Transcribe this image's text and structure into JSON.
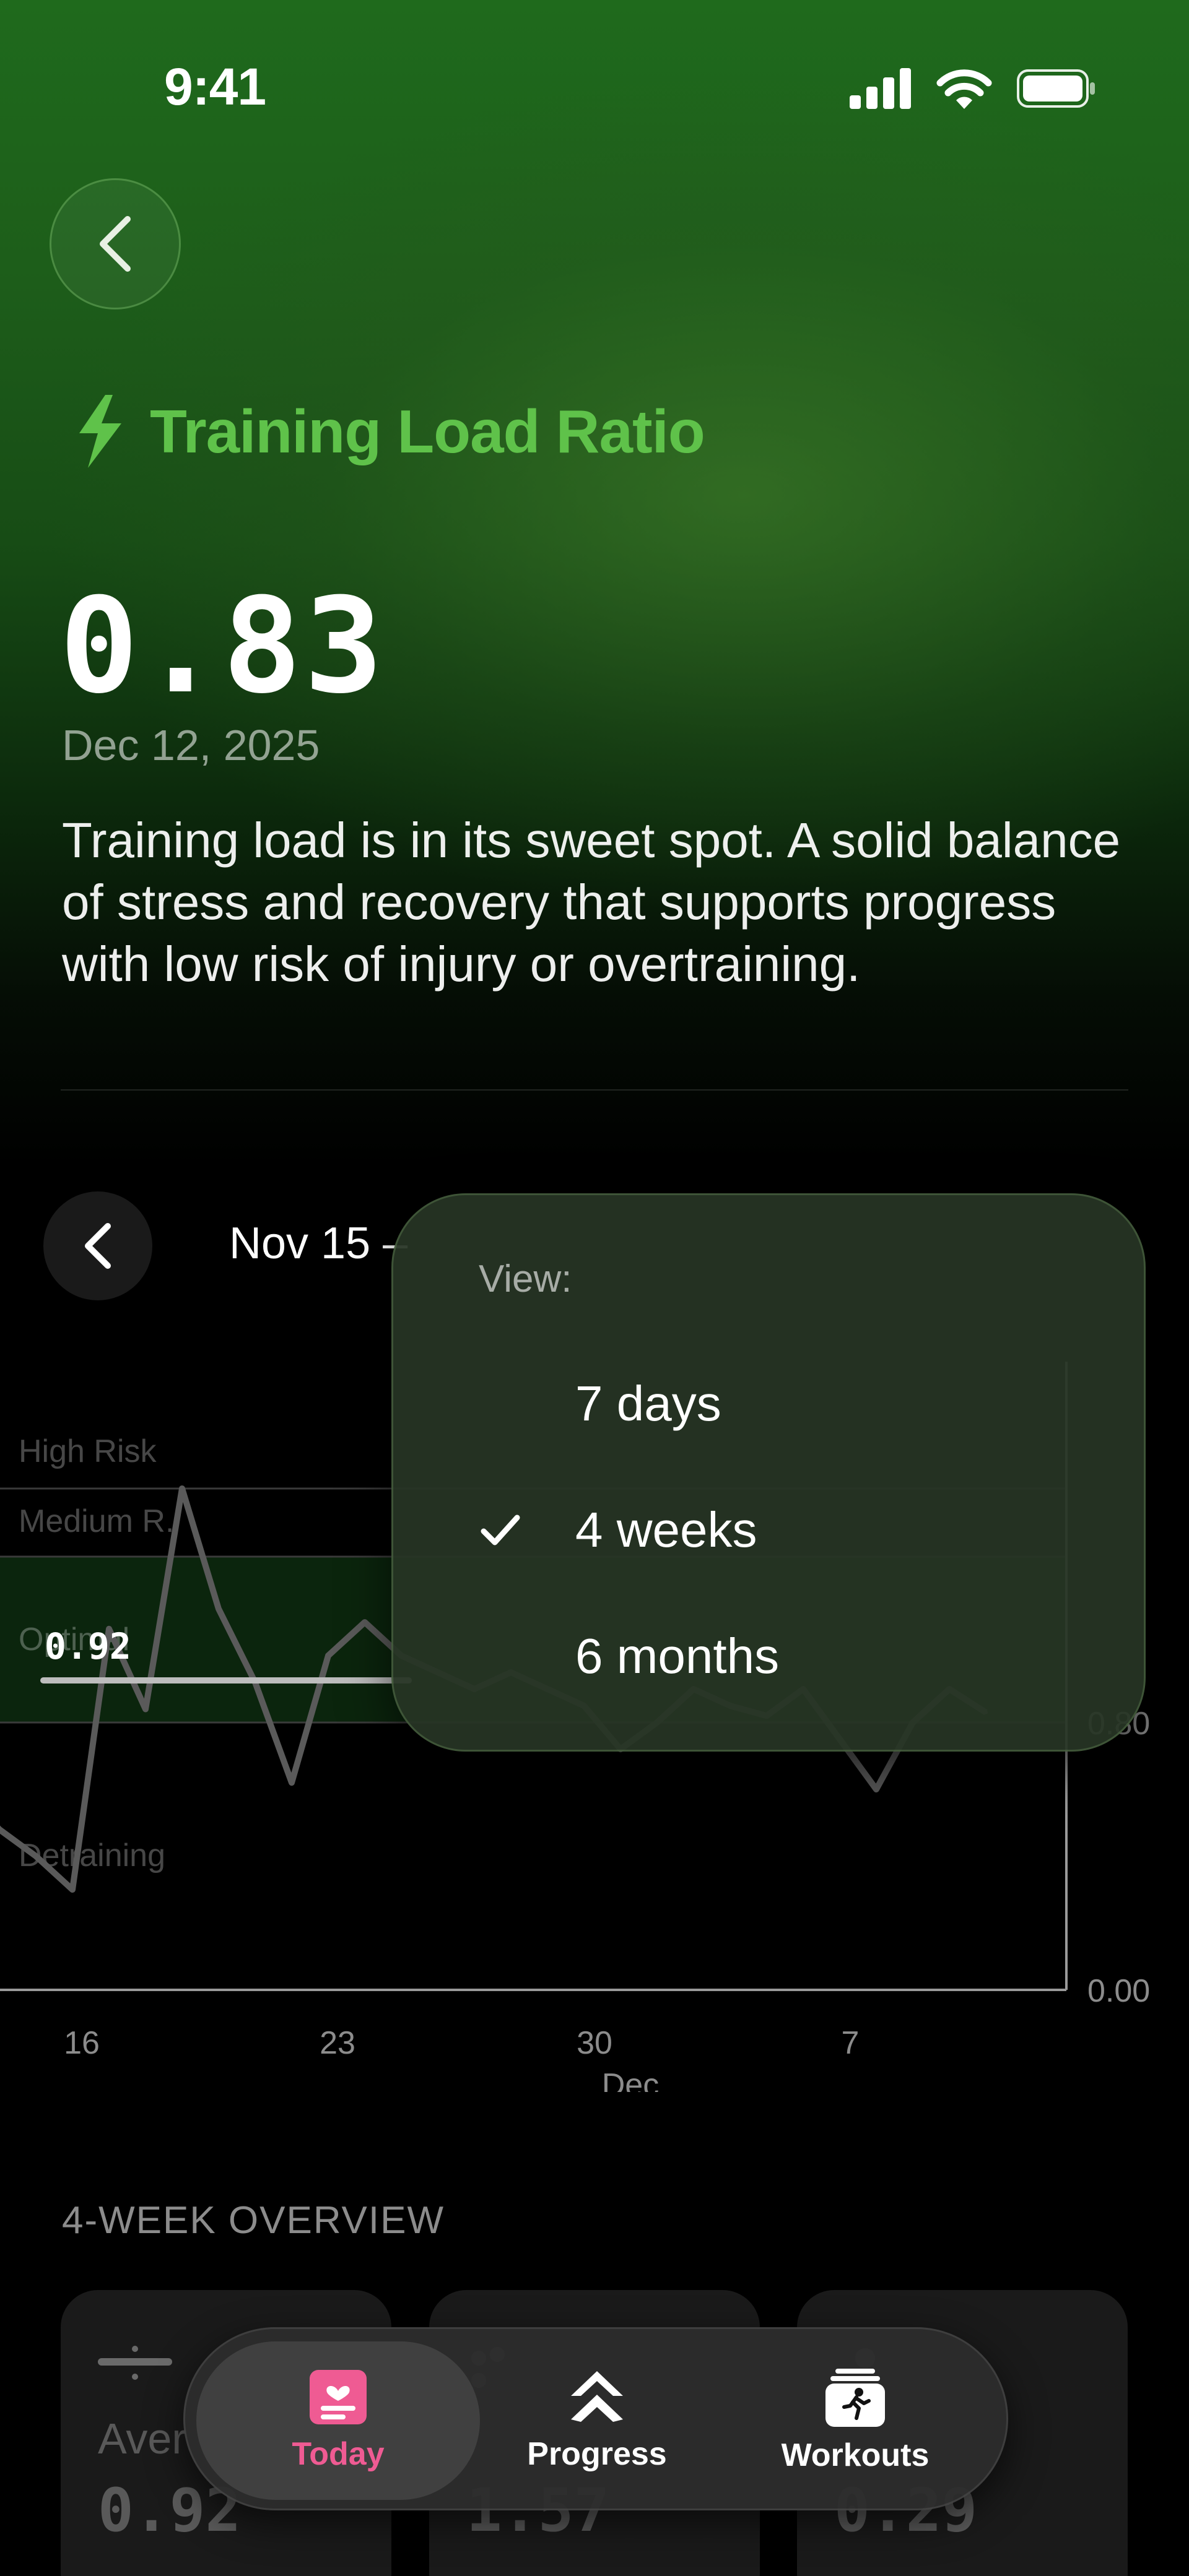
{
  "status_bar": {
    "time": "9:41"
  },
  "metric": {
    "title": "Training Load Ratio",
    "value": "0.83",
    "date": "Dec 12, 2025",
    "description": "Training load is in its sweet spot. A solid balance of stress and recovery that supports progress with low risk of injury or overtraining."
  },
  "range": {
    "label": "Nov 15 –"
  },
  "view_menu": {
    "header": "View:",
    "items": [
      {
        "label": "7 days",
        "selected": false
      },
      {
        "label": "4 weeks",
        "selected": true
      },
      {
        "label": "6 months",
        "selected": false
      }
    ]
  },
  "chart_data": {
    "type": "line",
    "zones": [
      "High Risk",
      "Medium R.",
      "Optimal",
      "Detraining"
    ],
    "x_ticks": [
      "16",
      "23",
      "30",
      "7"
    ],
    "x_month_label": "Dec",
    "y_ticks": [
      "0.80",
      "0.00"
    ],
    "current_value_label": "0.92",
    "ylim": [
      0,
      1.6
    ],
    "x": [
      14,
      15,
      16,
      17,
      18,
      19,
      20,
      21,
      22,
      23,
      24,
      25,
      26,
      27,
      28,
      29,
      30,
      1,
      2,
      3,
      4,
      5,
      6,
      7,
      8,
      9,
      10,
      11,
      12
    ],
    "values": [
      0.6,
      0.48,
      0.4,
      0.3,
      1.08,
      0.84,
      1.5,
      1.14,
      0.92,
      0.62,
      1.0,
      1.1,
      1.0,
      0.95,
      0.9,
      0.95,
      0.9,
      0.85,
      0.72,
      0.8,
      0.9,
      0.85,
      0.82,
      0.9,
      0.75,
      0.6,
      0.8,
      0.9,
      0.83
    ],
    "colors": {
      "line": "#5a5a5a",
      "zone_fill": "#0b250d",
      "axis": "#9a9a9a"
    }
  },
  "overview": {
    "title": "4-WEEK OVERVIEW",
    "cards": [
      {
        "label": "Aver",
        "value": "0.92"
      },
      {
        "label": "",
        "value": "1.57"
      },
      {
        "label": "",
        "value": "0.29"
      }
    ]
  },
  "tab_bar": {
    "tabs": [
      {
        "label": "Today",
        "icon": "today-icon",
        "active": true
      },
      {
        "label": "Progress",
        "icon": "progress-icon",
        "active": false
      },
      {
        "label": "Workouts",
        "icon": "workouts-icon",
        "active": false
      }
    ]
  },
  "colors": {
    "accent": "#5fc24a",
    "today_tab": "#ef5b93",
    "background": "#000000"
  }
}
